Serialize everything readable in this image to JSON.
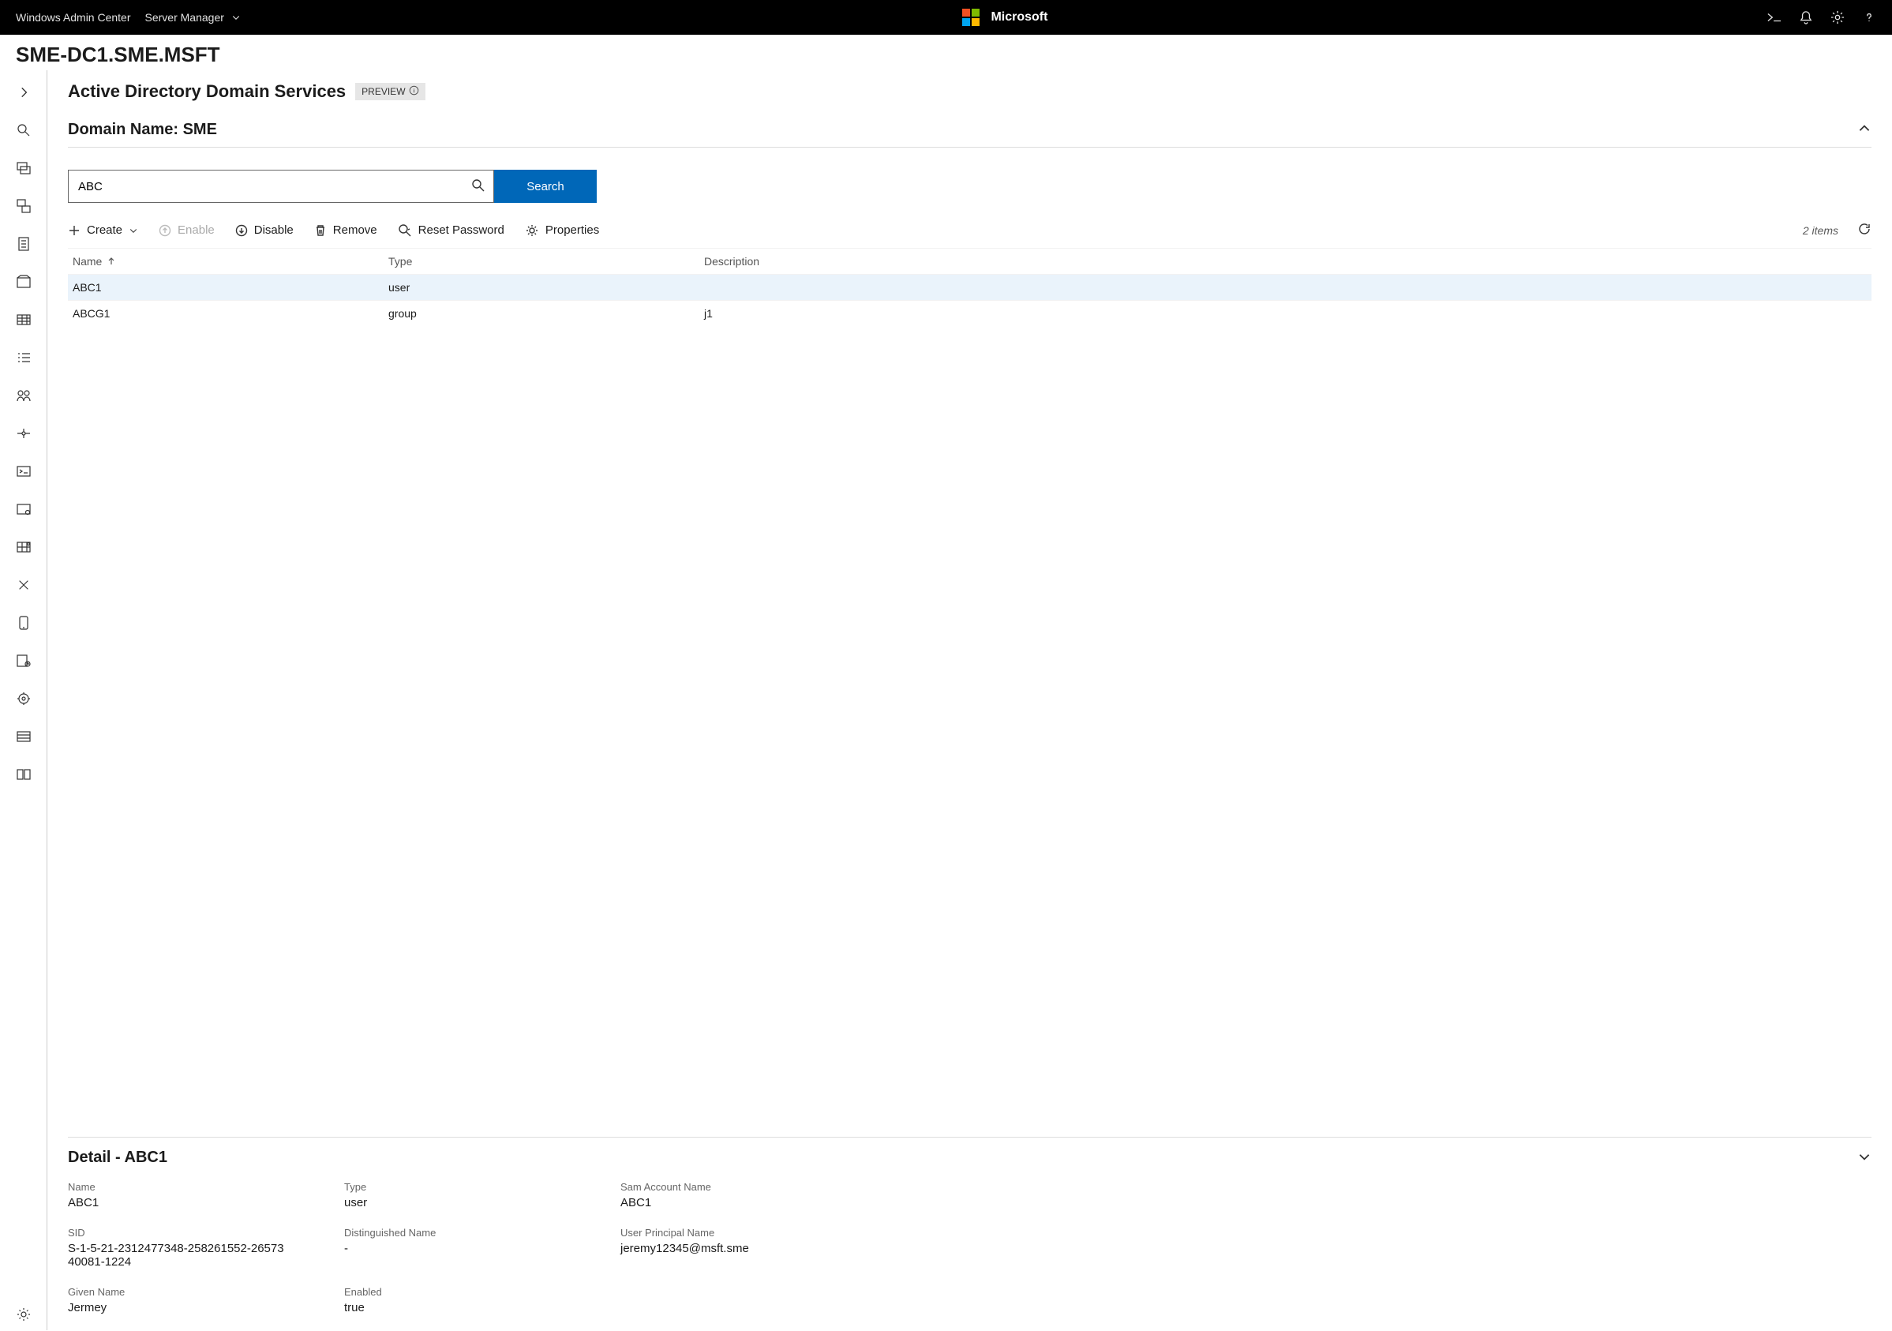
{
  "topbar": {
    "product": "Windows Admin Center",
    "context": "Server Manager",
    "brand": "Microsoft"
  },
  "server_name": "SME-DC1.SME.MSFT",
  "page": {
    "title": "Active Directory Domain Services",
    "preview_label": "PREVIEW",
    "domain_label": "Domain Name: SME"
  },
  "search": {
    "value": "ABC",
    "button": "Search"
  },
  "toolbar": {
    "create": "Create",
    "enable": "Enable",
    "disable": "Disable",
    "remove": "Remove",
    "reset_password": "Reset Password",
    "properties": "Properties",
    "item_count": "2 items"
  },
  "columns": {
    "name": "Name",
    "type": "Type",
    "description": "Description"
  },
  "rows": [
    {
      "name": "ABC1",
      "type": "user",
      "description": ""
    },
    {
      "name": "ABCG1",
      "type": "group",
      "description": "j1"
    }
  ],
  "detail": {
    "title": "Detail - ABC1",
    "fields": {
      "name_label": "Name",
      "name_value": "ABC1",
      "type_label": "Type",
      "type_value": "user",
      "sam_label": "Sam Account Name",
      "sam_value": "ABC1",
      "sid_label": "SID",
      "sid_value": "S-1-5-21-2312477348-258261552-2657340081-1224",
      "dn_label": "Distinguished Name",
      "dn_value": "-",
      "upn_label": "User Principal Name",
      "upn_value": "jeremy12345@msft.sme",
      "given_label": "Given Name",
      "given_value": "Jermey",
      "enabled_label": "Enabled",
      "enabled_value": "true"
    }
  }
}
